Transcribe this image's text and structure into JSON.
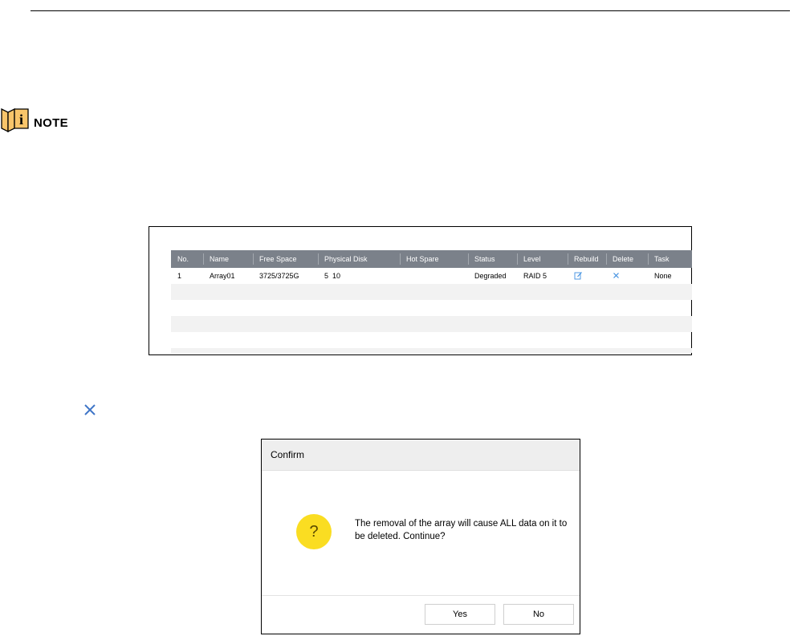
{
  "note": {
    "label": "NOTE"
  },
  "array_table": {
    "headers": [
      "No.",
      "Name",
      "Free Space",
      "Physical Disk",
      "Hot Spare",
      "Status",
      "Level",
      "Rebuild",
      "Delete",
      "Task"
    ],
    "rows": [
      {
        "no": "1",
        "name": "Array01",
        "free_space": "3725/3725G",
        "physical_disk": "5  10",
        "hot_spare": "",
        "status": "Degraded",
        "level": "RAID 5",
        "rebuild_icon": "edit-icon",
        "delete_icon": "delete-x-icon",
        "task": "None"
      }
    ],
    "icon_color": "#3f8fe0"
  },
  "confirm_dialog": {
    "title": "Confirm",
    "message": "The removal of the array will cause ALL data on it to be deleted. Continue?",
    "icon": "question-icon",
    "yes_label": "Yes",
    "no_label": "No"
  }
}
